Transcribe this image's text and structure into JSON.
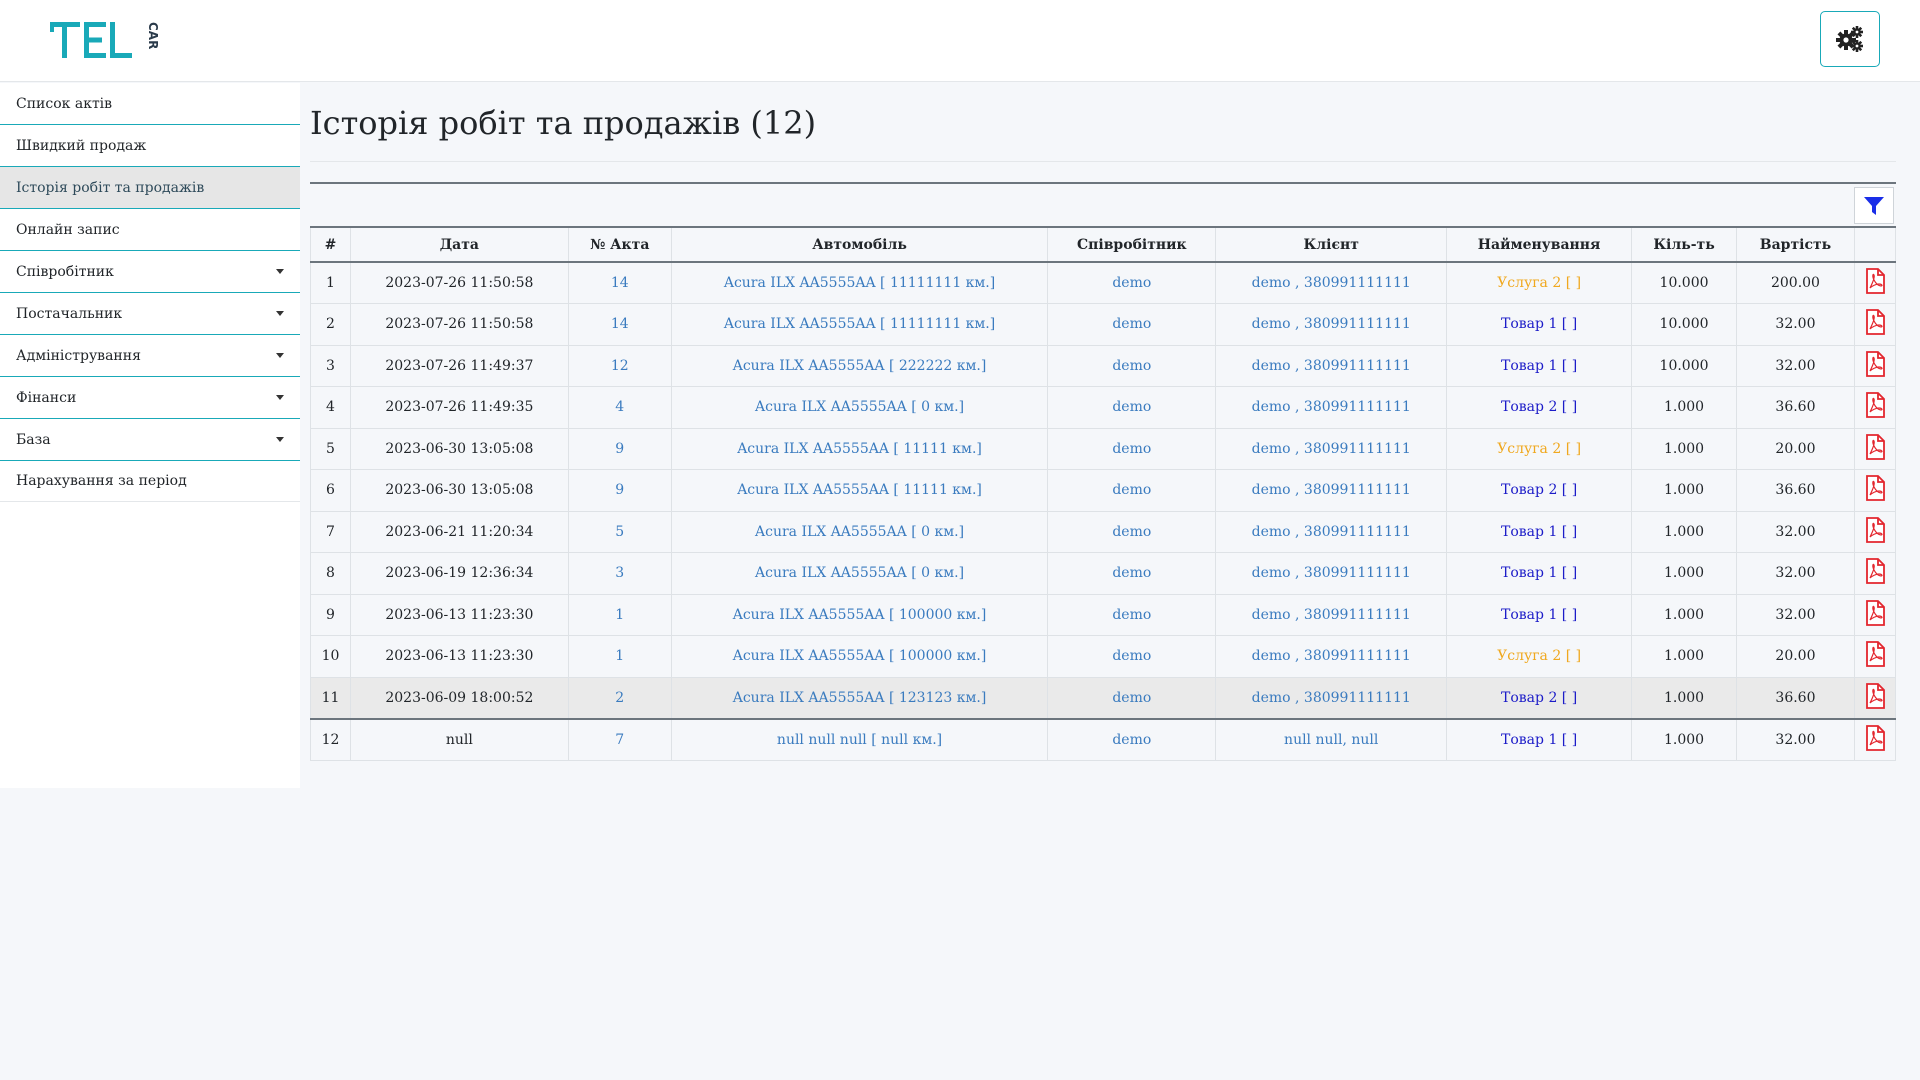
{
  "header": {
    "logo_main": "TEL",
    "logo_sub": "CAR"
  },
  "sidebar": {
    "items": [
      {
        "label": "Список актів",
        "has_caret": false
      },
      {
        "label": "Швидкий продаж",
        "has_caret": false
      },
      {
        "label": "Історія робіт та продажів",
        "has_caret": false,
        "active": true
      },
      {
        "label": "Онлайн запис",
        "has_caret": false
      },
      {
        "label": "Співробітник",
        "has_caret": true
      },
      {
        "label": "Постачальник",
        "has_caret": true
      },
      {
        "label": "Адміністрування",
        "has_caret": true
      },
      {
        "label": "Фінанси",
        "has_caret": true
      },
      {
        "label": "База",
        "has_caret": true
      },
      {
        "label": "Нарахування за період",
        "has_caret": false
      }
    ]
  },
  "page": {
    "title": "Історія робіт та продажів (12)"
  },
  "table": {
    "columns": [
      "#",
      "Дата",
      "№ Акта",
      "Автомобіль",
      "Співробітник",
      "Клієнт",
      "Найменування",
      "Кіль-ть",
      "Вартість",
      ""
    ],
    "rows": [
      {
        "n": "1",
        "date": "2023-07-26 11:50:58",
        "act": "14",
        "car": "Acura ILX AA5555AA [ 11111111 км.]",
        "employee": "demo",
        "client": "demo , 380991111111",
        "item": "Услуга 2 [ ]",
        "item_type": "service",
        "qty": "10.000",
        "price": "200.00"
      },
      {
        "n": "2",
        "date": "2023-07-26 11:50:58",
        "act": "14",
        "car": "Acura ILX AA5555AA [ 11111111 км.]",
        "employee": "demo",
        "client": "demo , 380991111111",
        "item": "Товар 1 [ ]",
        "item_type": "goods",
        "qty": "10.000",
        "price": "32.00"
      },
      {
        "n": "3",
        "date": "2023-07-26 11:49:37",
        "act": "12",
        "car": "Acura ILX AA5555AA [ 222222 км.]",
        "employee": "demo",
        "client": "demo , 380991111111",
        "item": "Товар 1 [ ]",
        "item_type": "goods",
        "qty": "10.000",
        "price": "32.00"
      },
      {
        "n": "4",
        "date": "2023-07-26 11:49:35",
        "act": "4",
        "car": "Acura ILX AA5555AA [ 0 км.]",
        "employee": "demo",
        "client": "demo , 380991111111",
        "item": "Товар 2 [ ]",
        "item_type": "goods",
        "qty": "1.000",
        "price": "36.60"
      },
      {
        "n": "5",
        "date": "2023-06-30 13:05:08",
        "act": "9",
        "car": "Acura ILX AA5555AA [ 11111 км.]",
        "employee": "demo",
        "client": "demo , 380991111111",
        "item": "Услуга 2 [ ]",
        "item_type": "service",
        "qty": "1.000",
        "price": "20.00"
      },
      {
        "n": "6",
        "date": "2023-06-30 13:05:08",
        "act": "9",
        "car": "Acura ILX AA5555AA [ 11111 км.]",
        "employee": "demo",
        "client": "demo , 380991111111",
        "item": "Товар 2 [ ]",
        "item_type": "goods",
        "qty": "1.000",
        "price": "36.60"
      },
      {
        "n": "7",
        "date": "2023-06-21 11:20:34",
        "act": "5",
        "car": "Acura ILX AA5555AA [ 0 км.]",
        "employee": "demo",
        "client": "demo , 380991111111",
        "item": "Товар 1 [ ]",
        "item_type": "goods",
        "qty": "1.000",
        "price": "32.00"
      },
      {
        "n": "8",
        "date": "2023-06-19 12:36:34",
        "act": "3",
        "car": "Acura ILX AA5555AA [ 0 км.]",
        "employee": "demo",
        "client": "demo , 380991111111",
        "item": "Товар 1 [ ]",
        "item_type": "goods",
        "qty": "1.000",
        "price": "32.00"
      },
      {
        "n": "9",
        "date": "2023-06-13 11:23:30",
        "act": "1",
        "car": "Acura ILX AA5555AA [ 100000 км.]",
        "employee": "demo",
        "client": "demo , 380991111111",
        "item": "Товар 1 [ ]",
        "item_type": "goods",
        "qty": "1.000",
        "price": "32.00"
      },
      {
        "n": "10",
        "date": "2023-06-13 11:23:30",
        "act": "1",
        "car": "Acura ILX AA5555AA [ 100000 км.]",
        "employee": "demo",
        "client": "demo , 380991111111",
        "item": "Услуга 2 [ ]",
        "item_type": "service",
        "qty": "1.000",
        "price": "20.00"
      },
      {
        "n": "11",
        "date": "2023-06-09 18:00:52",
        "act": "2",
        "car": "Acura ILX AA5555AA [ 123123 км.]",
        "employee": "demo",
        "client": "demo , 380991111111",
        "item": "Товар 2 [ ]",
        "item_type": "goods",
        "qty": "1.000",
        "price": "36.60",
        "highlight": true
      },
      {
        "n": "12",
        "date": "null",
        "act": "7",
        "car": "null null null [ null км.]",
        "employee": "demo",
        "client": "null null, null",
        "item": "Товар 1 [ ]",
        "item_type": "goods",
        "qty": "1.000",
        "price": "32.00"
      }
    ]
  },
  "icons": {
    "settings": "gears-icon",
    "filter": "filter-icon",
    "pdf": "pdf-file-icon"
  },
  "colors": {
    "accent": "#19a9b8",
    "link": "#3a7bbf",
    "goods": "#1c1cc8",
    "service": "#f0a81e",
    "pdf": "#e3262e",
    "filter": "#1a2ee8"
  }
}
